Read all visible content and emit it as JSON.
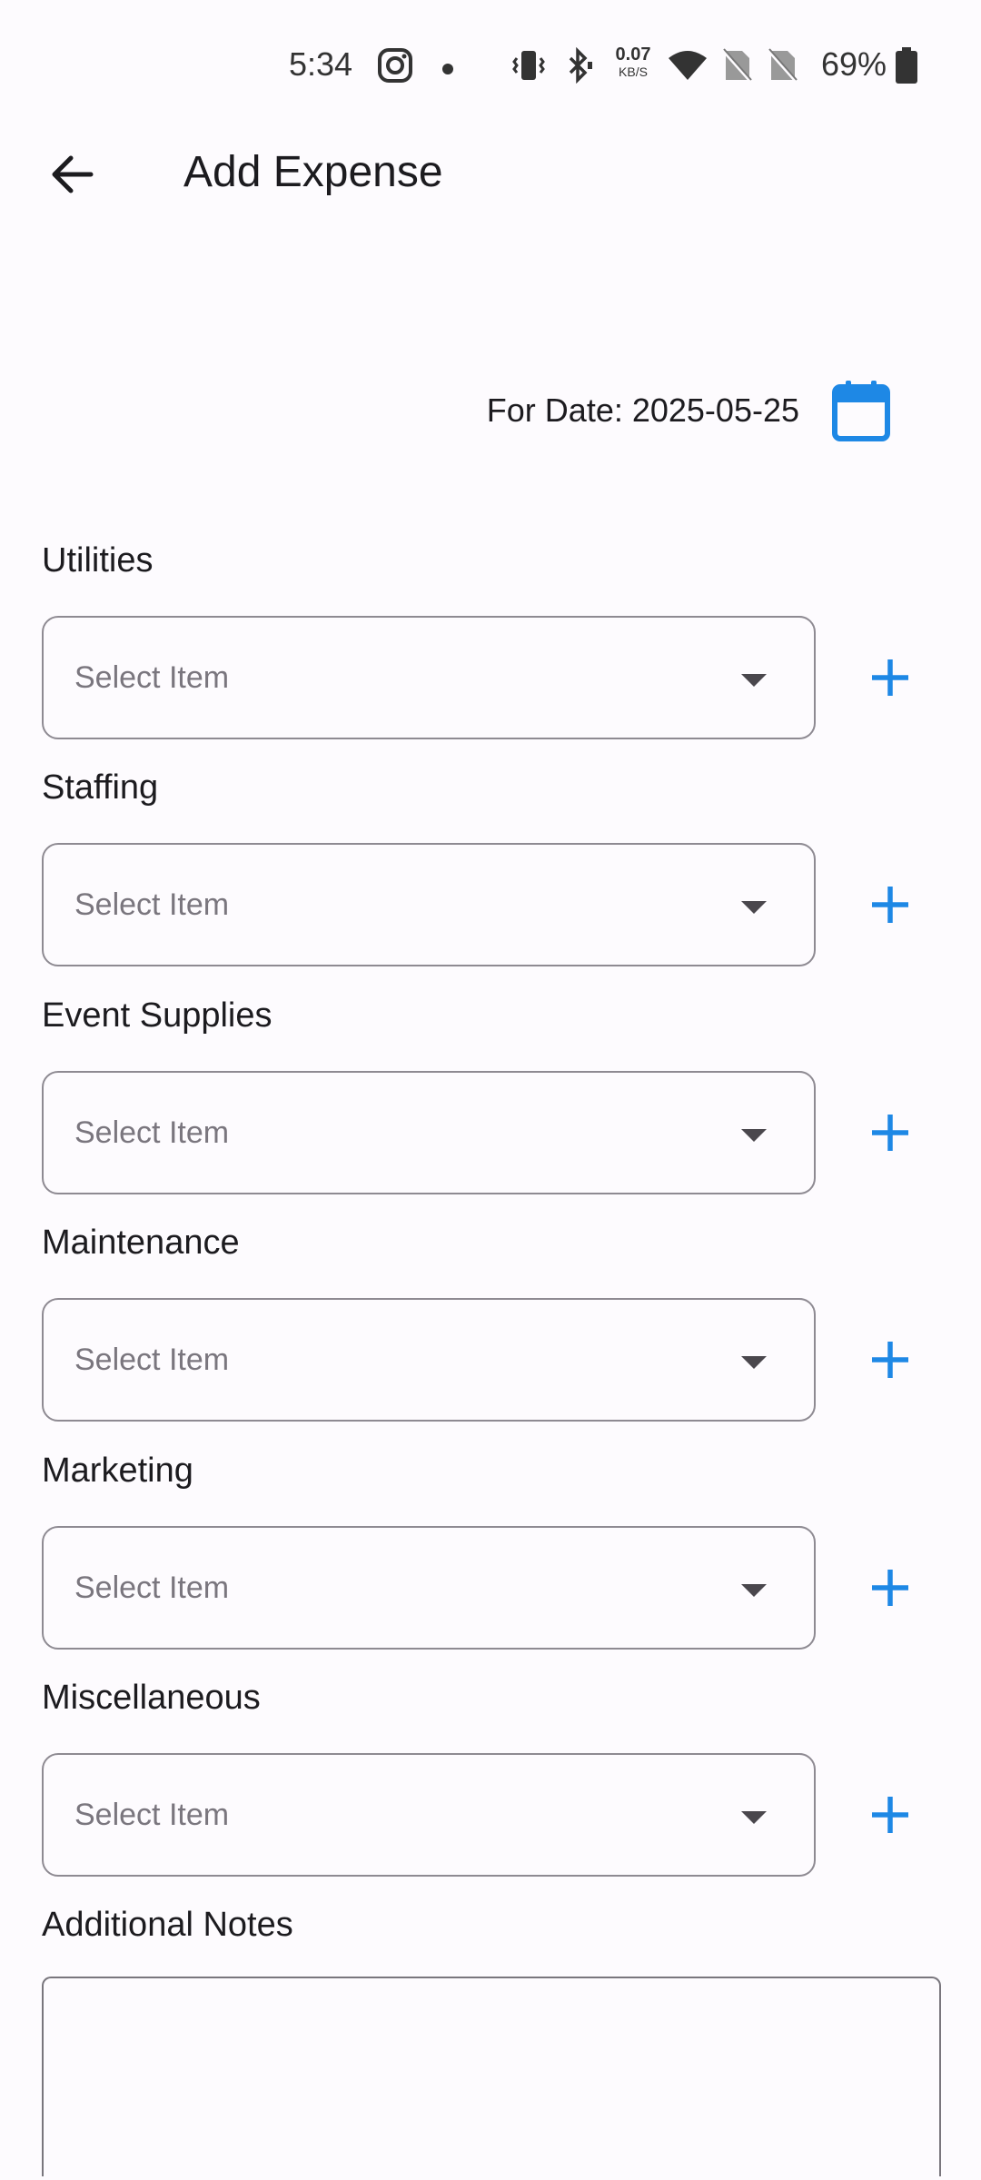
{
  "status_bar": {
    "time": "5:34",
    "net_speed_value": "0.07",
    "net_speed_unit": "KB/S",
    "battery": "69%",
    "icons": [
      "instagram-icon",
      "notification-dot",
      "vibrate-icon",
      "bluetooth-icon",
      "wifi-icon",
      "no-sim-icon",
      "no-sim-icon",
      "battery-icon"
    ]
  },
  "app_bar": {
    "title": "Add Expense",
    "back_icon": "arrow-back-icon"
  },
  "date": {
    "label": "For Date: 2025-05-25",
    "icon": "calendar-icon"
  },
  "categories": [
    {
      "label": "Utilities",
      "placeholder": "Select Item"
    },
    {
      "label": "Staffing",
      "placeholder": "Select Item"
    },
    {
      "label": "Event Supplies",
      "placeholder": "Select Item"
    },
    {
      "label": "Maintenance",
      "placeholder": "Select Item"
    },
    {
      "label": "Marketing",
      "placeholder": "Select Item"
    },
    {
      "label": "Miscellaneous",
      "placeholder": "Select Item"
    }
  ],
  "notes": {
    "label": "Additional Notes",
    "value": ""
  },
  "colors": {
    "accent": "#1e88e5",
    "background": "#fdfbfe",
    "outline": "#8e8a92"
  }
}
